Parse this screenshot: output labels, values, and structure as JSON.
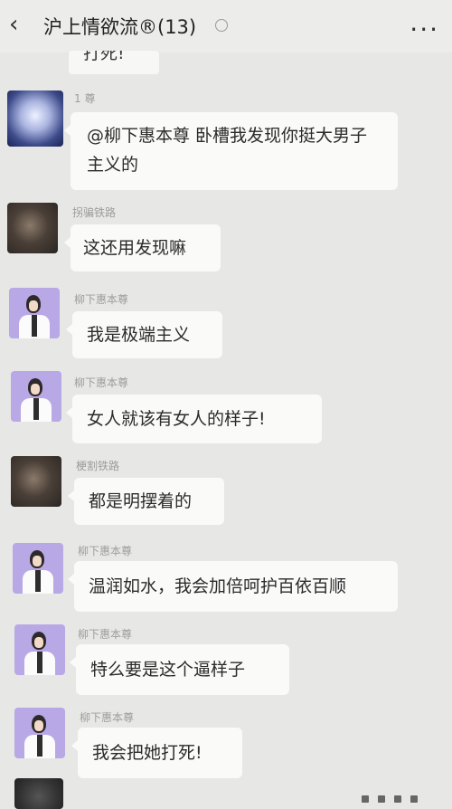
{
  "header": {
    "back_icon": "chevron-left-icon",
    "title": "沪上情欲流®(13)",
    "more_label": "..."
  },
  "partial_top_text": "打死!",
  "messages": [
    {
      "sender": "1 尊",
      "text": "@柳下惠本尊  卧槽我发现你挺大男子主义的",
      "avatar": "group-image"
    },
    {
      "sender": "拐骗铁路",
      "text": "这还用发现嘛",
      "avatar": "fuzzy-image"
    },
    {
      "sender": "柳下惠本尊",
      "text": "我是极端主义",
      "avatar": "person-image"
    },
    {
      "sender": "柳下惠本尊",
      "text": "女人就该有女人的样子!",
      "avatar": "person-image"
    },
    {
      "sender": "梗割铁路",
      "text": "都是明摆着的",
      "avatar": "fuzzy-image"
    },
    {
      "sender": "柳下惠本尊",
      "text": "温润如水，我会加倍呵护百依百顺",
      "avatar": "person-image"
    },
    {
      "sender": "柳下惠本尊",
      "text": "特么要是这个逼样子",
      "avatar": "person-image"
    },
    {
      "sender": "柳下惠本尊",
      "text": "我会把她打死!",
      "avatar": "person-image"
    }
  ]
}
